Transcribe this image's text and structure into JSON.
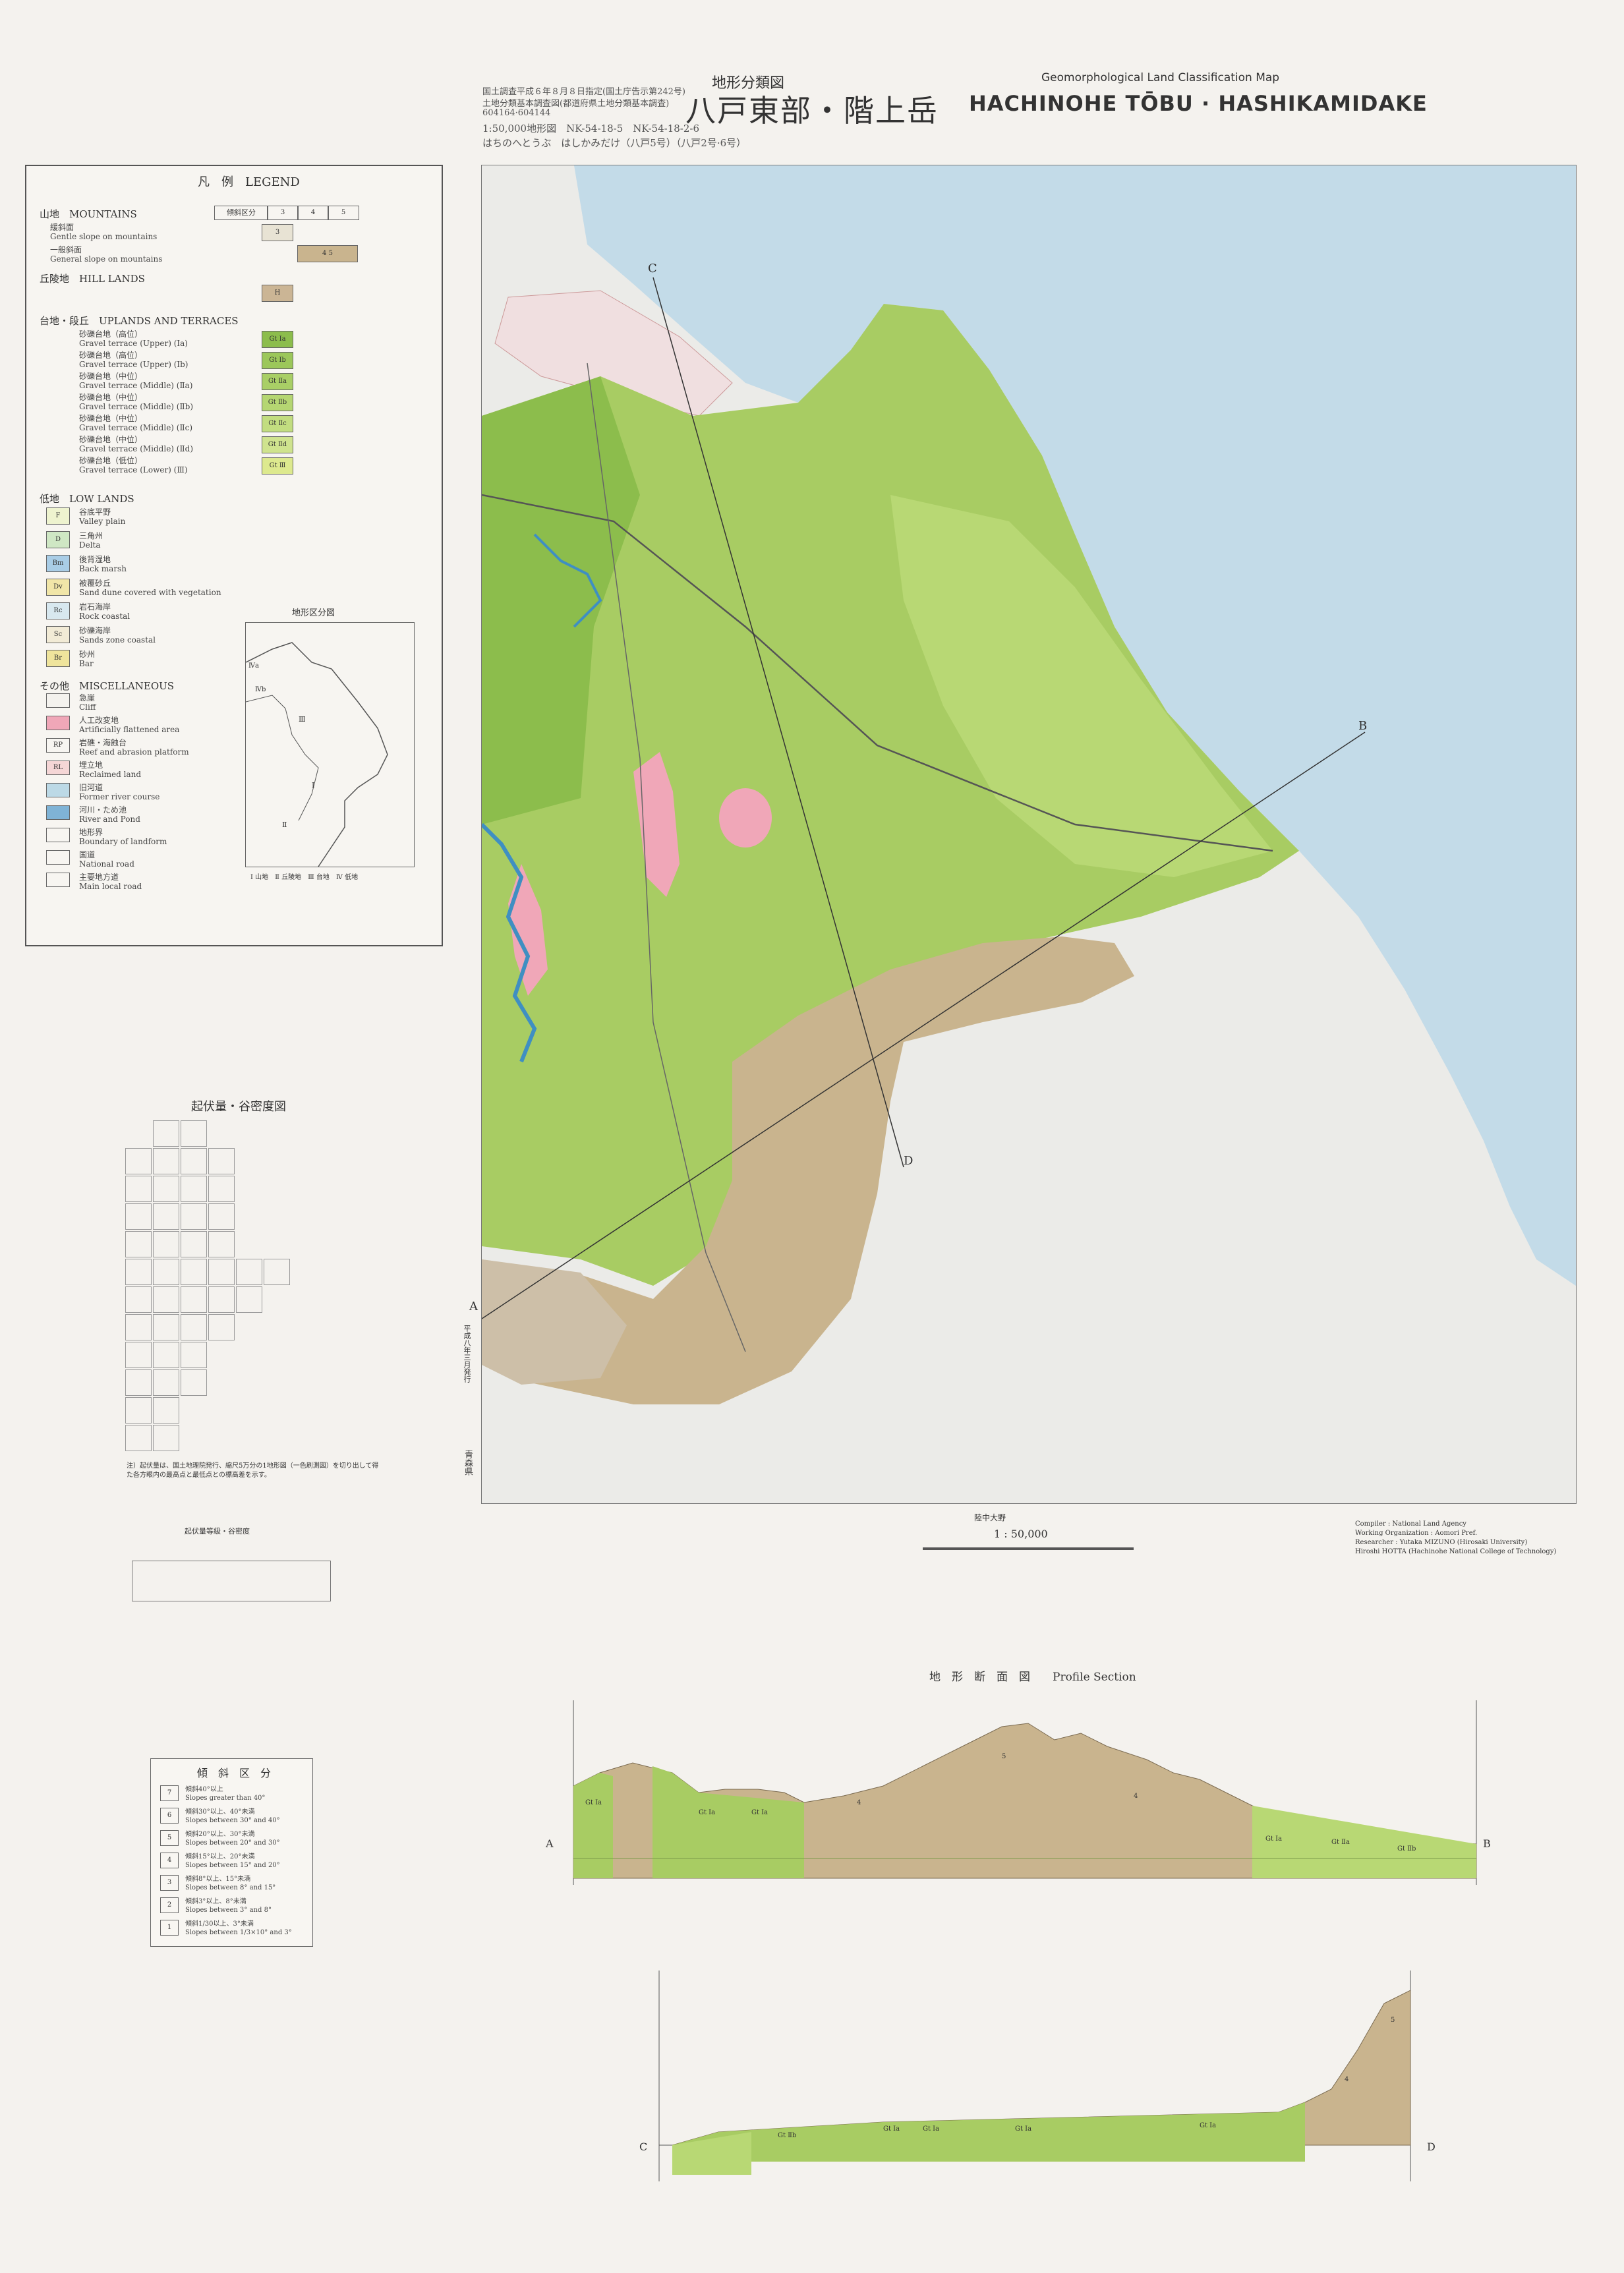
{
  "header": {
    "small_title": "地形分類図",
    "jp_title": "八戸東部・階上岳",
    "en_subtitle": "Geomorphological Land Classification Map",
    "en_title": "HACHINOHE TŌBU · HASHIKAMIDAKE",
    "note_lines": [
      "国土調査平成６年８月８日指定(国土庁告示第242号)",
      "土地分類基本調査図(都道府県土地分類基本調査)",
      "604164·604144",
      "1:50,000地形図　NK-54-18-5　NK-54-18-2-6",
      "はちのへとうぶ　はしかみだけ（八戸5号）（八戸2号·6号）"
    ]
  },
  "legend": {
    "title": "凡　例　LEGEND",
    "slope_header": "傾斜区分",
    "slope_cols": [
      "3",
      "4",
      "5"
    ],
    "sections": [
      {
        "label": "山地　MOUNTAINS",
        "items": [
          {
            "jp": "緩斜面",
            "en": "Gentle slope on mountains",
            "code": "3",
            "color": "#e8e3d4"
          },
          {
            "jp": "一般斜面",
            "en": "General slope on mountains",
            "code": "4 5",
            "color": "#c9b48e"
          }
        ]
      },
      {
        "label": "丘陵地　HILL LANDS",
        "items": [
          {
            "jp": "",
            "en": "",
            "code": "H",
            "color": "#cbb595"
          }
        ]
      },
      {
        "label": "台地・段丘　UPLANDS AND TERRACES",
        "items": [
          {
            "jp": "砂礫台地（高位）",
            "en": "Gravel terrace (Upper) (Ⅰa)",
            "code": "Gt Ⅰa",
            "color": "#8cbd4c"
          },
          {
            "jp": "砂礫台地（高位）",
            "en": "Gravel terrace (Upper) (Ⅰb)",
            "code": "Gt Ⅰb",
            "color": "#9cc75a"
          },
          {
            "jp": "砂礫台地（中位）",
            "en": "Gravel terrace (Middle) (Ⅱa)",
            "code": "Gt Ⅱa",
            "color": "#a9cf66"
          },
          {
            "jp": "砂礫台地（中位）",
            "en": "Gravel terrace (Middle) (Ⅱb)",
            "code": "Gt Ⅱb",
            "color": "#b5d672"
          },
          {
            "jp": "砂礫台地（中位）",
            "en": "Gravel terrace (Middle) (Ⅱc)",
            "code": "Gt Ⅱc",
            "color": "#c2dd80"
          },
          {
            "jp": "砂礫台地（中位）",
            "en": "Gravel terrace (Middle) (Ⅱd)",
            "code": "Gt Ⅱd",
            "color": "#cfe38e"
          },
          {
            "jp": "砂礫台地（低位）",
            "en": "Gravel terrace (Lower) (Ⅲ)",
            "code": "Gt Ⅲ",
            "color": "#dde98e"
          }
        ]
      },
      {
        "label": "低地　LOW LANDS",
        "items": [
          {
            "jp": "谷底平野",
            "en": "Valley plain",
            "code": "F",
            "color": "#eef3cf"
          },
          {
            "jp": "三角州",
            "en": "Delta",
            "code": "D",
            "color": "#cfe7c4"
          },
          {
            "jp": "後背湿地",
            "en": "Back marsh",
            "code": "Bm",
            "color": "#a9cde6"
          },
          {
            "jp": "被覆砂丘",
            "en": "Sand dune covered with vegetation",
            "code": "Dv",
            "color": "#f1e6a8"
          },
          {
            "jp": "岩石海岸",
            "en": "Rock coastal",
            "code": "Rc",
            "color": "#d8e8ef"
          },
          {
            "jp": "砂礫海岸",
            "en": "Sands zone coastal",
            "code": "Sc",
            "color": "#f2ebd6"
          },
          {
            "jp": "砂州",
            "en": "Bar",
            "code": "Br",
            "color": "#efe49c"
          }
        ]
      },
      {
        "label": "その他　MISCELLANEOUS",
        "items": [
          {
            "jp": "急崖",
            "en": "Cliff",
            "code": "",
            "color": "#f4f2ee"
          },
          {
            "jp": "人工改変地",
            "en": "Artificially flattened area",
            "code": "",
            "color": "#f0a7b8"
          },
          {
            "jp": "岩礁・海蝕台",
            "en": "Reef and abrasion platform",
            "code": "RP",
            "color": "#f7f5f1"
          },
          {
            "jp": "埋立地",
            "en": "Reclaimed land",
            "code": "RL",
            "color": "#f5d6d6"
          },
          {
            "jp": "旧河道",
            "en": "Former river course",
            "code": "",
            "color": "#bcd9e6"
          },
          {
            "jp": "河川・ため池",
            "en": "River and Pond",
            "code": "",
            "color": "#7fb3d6"
          },
          {
            "jp": "地形界",
            "en": "Boundary of landform",
            "code": "",
            "color": "#f7f5f1"
          },
          {
            "jp": "国道",
            "en": "National road",
            "code": "",
            "color": "#f7f5f1"
          },
          {
            "jp": "主要地方道",
            "en": "Main local road",
            "code": "",
            "color": "#f7f5f1"
          }
        ]
      }
    ],
    "index_title": "地形区分図",
    "index_labels": [
      "Ⅰ",
      "Ⅱ",
      "Ⅲ",
      "Ⅳa",
      "Ⅳb"
    ],
    "index_caption": "Ⅰ 山地　Ⅱ 丘陵地　Ⅲ 台地　Ⅳ 低地"
  },
  "map": {
    "sea_color": "#c3dbe8",
    "terrace_color": "#a8cc63",
    "mountain_color": "#c9b48e",
    "labels": [
      "B",
      "C",
      "D",
      "A",
      "1 : 50,000",
      "陸中大野",
      "平成八年三月発行",
      "青森県"
    ],
    "credits": [
      "Compiler : National Land Agency",
      "Working Organization : Aomori Pref.",
      "Researcher : Yutaka MIZUNO (Hirosaki University)",
      "Hiroshi HOTTA (Hachinohe National College of Technology)"
    ]
  },
  "relief": {
    "title": "起伏量・谷密度図",
    "note": "注）起伏量は、国土地理院発行、縮尺5万分の1地形図（一色刷測図）を切り出して得た各方眼内の最高点と最低点との標高差を示す。",
    "table_title": "起伏量等級・谷密度"
  },
  "slope": {
    "title": "傾　斜　区　分",
    "rows": [
      {
        "n": "7",
        "jp": "傾斜40°以上",
        "en": "Slopes greater than 40°"
      },
      {
        "n": "6",
        "jp": "傾斜30°以上、40°未満",
        "en": "Slopes between 30° and 40°"
      },
      {
        "n": "5",
        "jp": "傾斜20°以上、30°未満",
        "en": "Slopes between 20° and 30°"
      },
      {
        "n": "4",
        "jp": "傾斜15°以上、20°未満",
        "en": "Slopes between 15° and 20°"
      },
      {
        "n": "3",
        "jp": "傾斜8°以上、15°未満",
        "en": "Slopes between 8° and 15°"
      },
      {
        "n": "2",
        "jp": "傾斜3°以上、8°未満",
        "en": "Slopes between 3° and 8°"
      },
      {
        "n": "1",
        "jp": "傾斜1/30以上、3°未満",
        "en": "Slopes between 1/3×10° and 3°"
      }
    ]
  },
  "profile": {
    "title": "地　形　断　面　図　　Profile Section",
    "ab_labels": [
      "A",
      "B"
    ],
    "cd_labels": [
      "C",
      "D"
    ],
    "ab_units": [
      "Gt Ⅰa",
      "Gt Ⅰa",
      "Gt Ⅰa",
      "4",
      "5",
      "4",
      "Gt Ⅰa",
      "Gt Ⅱa",
      "Gt Ⅱb"
    ],
    "cd_units": [
      "Gt Ⅱb",
      "Gt Ⅰa",
      "Gt Ⅰa",
      "Gt Ⅰa",
      "Gt Ⅰa",
      "4",
      "5"
    ]
  }
}
